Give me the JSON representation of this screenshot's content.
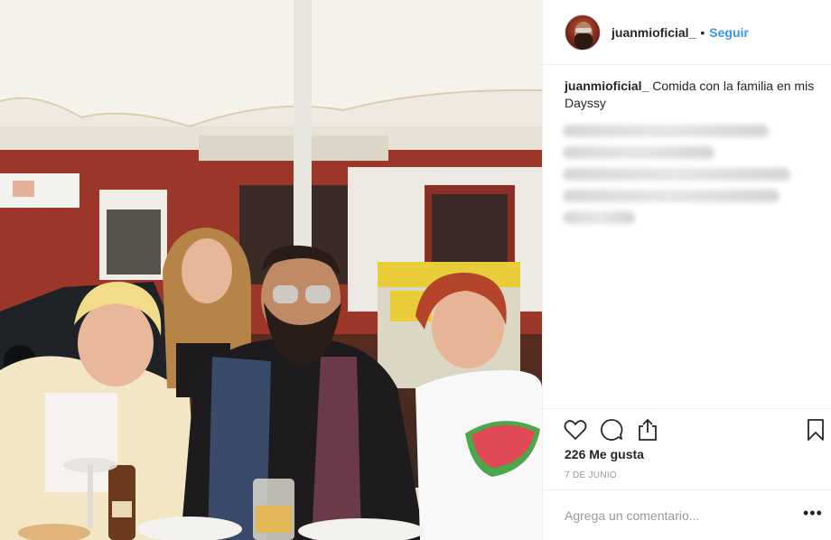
{
  "post": {
    "username": "juanmioficial_",
    "separator": "•",
    "follow_label": "Seguir",
    "caption_user": "juanmioficial_",
    "caption_text": "Comida con la familia en mis Dayssy",
    "likes": "226 Me gusta",
    "date": "7 DE JUNIO",
    "comment_placeholder": "Agrega un comentario...",
    "more_label": "•••"
  },
  "icons": {
    "like": "heart-icon",
    "comment": "comment-bubble-icon",
    "share": "share-icon",
    "save": "bookmark-icon",
    "more": "more-options-icon"
  },
  "colors": {
    "link": "#3897f0",
    "text": "#262626",
    "muted": "#999999",
    "divider": "#efefef"
  }
}
